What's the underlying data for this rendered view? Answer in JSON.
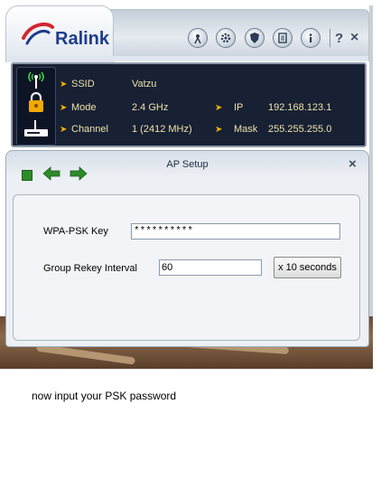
{
  "app": {
    "logo_text": "Ralink",
    "toolbar": {
      "help_label": "?",
      "close_label": "×"
    }
  },
  "status": {
    "rows": [
      {
        "label": "SSID",
        "value": "Vatzu"
      },
      {
        "label": "Mode",
        "value": "2.4 GHz"
      },
      {
        "label": "Channel",
        "value": "1 (2412 MHz)"
      },
      {
        "label": "IP",
        "value": "192.168.123.1"
      },
      {
        "label": "Mask",
        "value": "255.255.255.0"
      }
    ]
  },
  "dialog": {
    "title": "AP Setup",
    "close_label": "×",
    "wpa_label": "WPA-PSK Key",
    "wpa_value": "**********",
    "rekey_label": "Group Rekey Interval",
    "rekey_value": "60",
    "unit_button": "x 10 seconds"
  },
  "caption": "now input your PSK password",
  "colors": {
    "status_bg": "#182034",
    "status_text": "#ece2a8",
    "arrow": "#f2b400",
    "brand": "#1d3c8c"
  }
}
